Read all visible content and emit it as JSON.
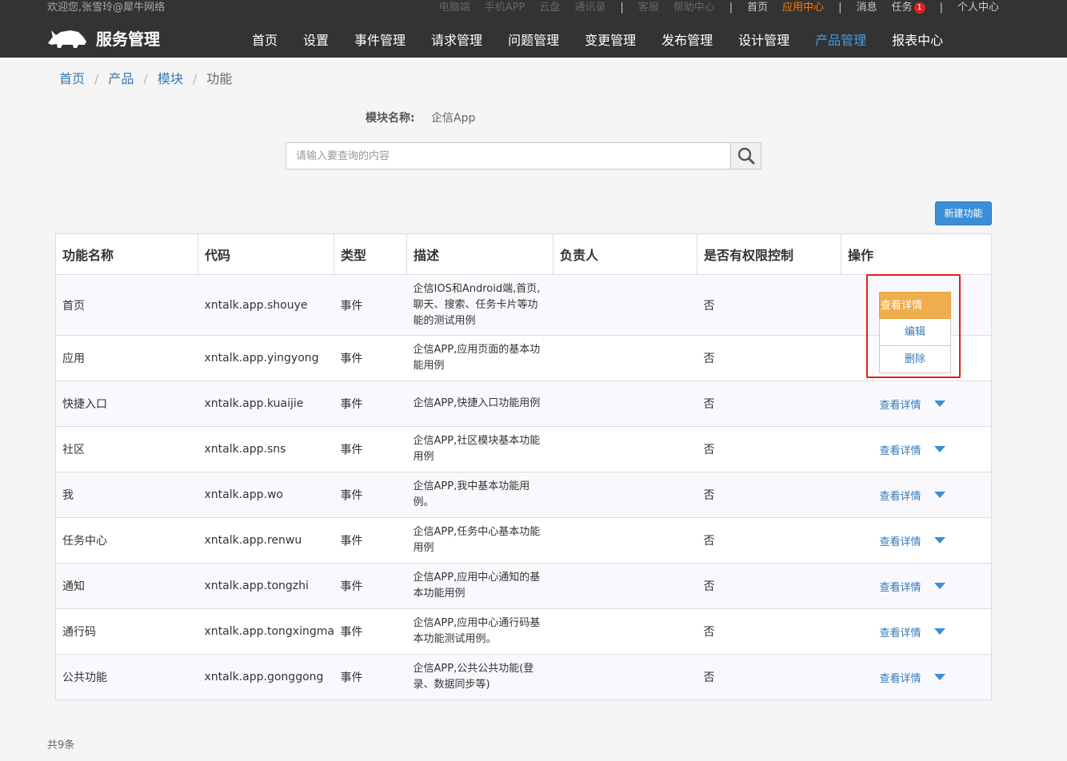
{
  "header": {
    "welcome": "欢迎您,张雪玲@犀牛网络",
    "links": {
      "pc": "电脑端",
      "mobile_app": "手机APP",
      "cloud": "云盘",
      "contacts": "通讯录",
      "service": "客服",
      "help": "帮助中心",
      "home": "首页",
      "app_center": "应用中心",
      "messages": "消息",
      "tasks": "任务",
      "task_count": "1",
      "profile": "个人中心"
    },
    "logo_text": "服务管理",
    "nav": [
      "首页",
      "设置",
      "事件管理",
      "请求管理",
      "问题管理",
      "变更管理",
      "发布管理",
      "设计管理",
      "产品管理",
      "报表中心"
    ],
    "nav_active": "产品管理"
  },
  "breadcrumb": [
    "首页",
    "产品",
    "模块",
    "功能"
  ],
  "module": {
    "label": "模块名称:",
    "value": "企信App"
  },
  "search": {
    "placeholder": "请输入要查询的内容"
  },
  "new_button": "新建功能",
  "table": {
    "headers": [
      "功能名称",
      "代码",
      "类型",
      "描述",
      "负责人",
      "是否有权限控制",
      "操作"
    ],
    "rows": [
      {
        "name": "首页",
        "code": "xntalk.app.shouye",
        "type": "事件",
        "desc": "企信IOS和Android端,首页,聊天、搜索、任务卡片等功能的测试用例",
        "owner": "",
        "perm": "否"
      },
      {
        "name": "应用",
        "code": "xntalk.app.yingyong",
        "type": "事件",
        "desc": "企信APP,应用页面的基本功能用例",
        "owner": "",
        "perm": "否"
      },
      {
        "name": "快捷入口",
        "code": "xntalk.app.kuaijie",
        "type": "事件",
        "desc": "企信APP,快捷入口功能用例",
        "owner": "",
        "perm": "否"
      },
      {
        "name": "社区",
        "code": "xntalk.app.sns",
        "type": "事件",
        "desc": "企信APP,社区模块基本功能用例",
        "owner": "",
        "perm": "否"
      },
      {
        "name": "我",
        "code": "xntalk.app.wo",
        "type": "事件",
        "desc": "企信APP,我中基本功能用例。",
        "owner": "",
        "perm": "否"
      },
      {
        "name": "任务中心",
        "code": "xntalk.app.renwu",
        "type": "事件",
        "desc": "企信APP,任务中心基本功能用例",
        "owner": "",
        "perm": "否"
      },
      {
        "name": "通知",
        "code": "xntalk.app.tongzhi",
        "type": "事件",
        "desc": "企信APP,应用中心通知的基本功能用例",
        "owner": "",
        "perm": "否"
      },
      {
        "name": "通行码",
        "code": "xntalk.app.tongxingma",
        "type": "事件",
        "desc": "企信APP,应用中心通行码基本功能测试用例。",
        "owner": "",
        "perm": "否"
      },
      {
        "name": "公共功能",
        "code": "xntalk.app.gonggong",
        "type": "事件",
        "desc": "企信APP,公共公共功能(登录、数据同步等)",
        "owner": "",
        "perm": "否"
      }
    ],
    "action_label": "查看详情"
  },
  "dropdown": {
    "main": "查看详情",
    "edit": "编辑",
    "delete": "删除"
  },
  "total": "共9条",
  "colors": {
    "topbar": "#333333",
    "accent": "#3b8fd9",
    "active_orange": "#ff7a00",
    "dropdown_orange": "#f0ad4e",
    "highlight_red": "#e51c1c"
  }
}
